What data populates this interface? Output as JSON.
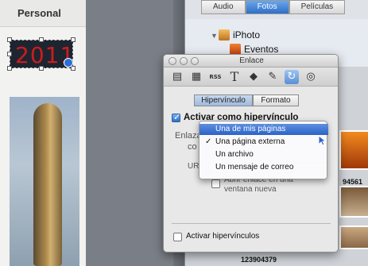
{
  "document": {
    "section_label": "Personal",
    "year_text": "2011"
  },
  "media_browser": {
    "tabs": [
      {
        "label": "Audio",
        "active": false
      },
      {
        "label": "Fotos",
        "active": true
      },
      {
        "label": "Películas",
        "active": false
      }
    ],
    "sources": [
      "iPhoto",
      "Eventos"
    ],
    "thumb_labels": [
      "94561",
      "123904379"
    ]
  },
  "inspector": {
    "title": "Enlace",
    "toolbar_icons": [
      "document-icon",
      "layout-icon",
      "rss-icon",
      "text-icon",
      "graphic-icon",
      "metrics-icon",
      "link-icon",
      "quicktime-icon"
    ],
    "segments": [
      {
        "label": "Hipervínculo",
        "active": true
      },
      {
        "label": "Formato",
        "active": false
      }
    ],
    "enable_hyperlink_label": "Activar como hipervínculo",
    "enable_hyperlink_checked": true,
    "link_to_label": "Enlaza",
    "link_to_label_2": "co",
    "url_label": "URL",
    "open_new_window_label": "Abrir enlace en una ventana nueva",
    "open_new_window_checked": false,
    "activate_hyperlinks_label": "Activar hipervínculos",
    "activate_hyperlinks_checked": false
  },
  "dropdown": {
    "items": [
      {
        "label": "Una de mis páginas",
        "highlighted": true,
        "checked": false
      },
      {
        "label": "Una página externa",
        "highlighted": false,
        "checked": true
      },
      {
        "label": "Un archivo",
        "highlighted": false,
        "checked": false
      },
      {
        "label": "Un mensaje de correo",
        "highlighted": false,
        "checked": false
      }
    ],
    "checkmark": "✓"
  },
  "colors": {
    "accent": "#2c63c6",
    "year_red": "#c81e1e"
  }
}
